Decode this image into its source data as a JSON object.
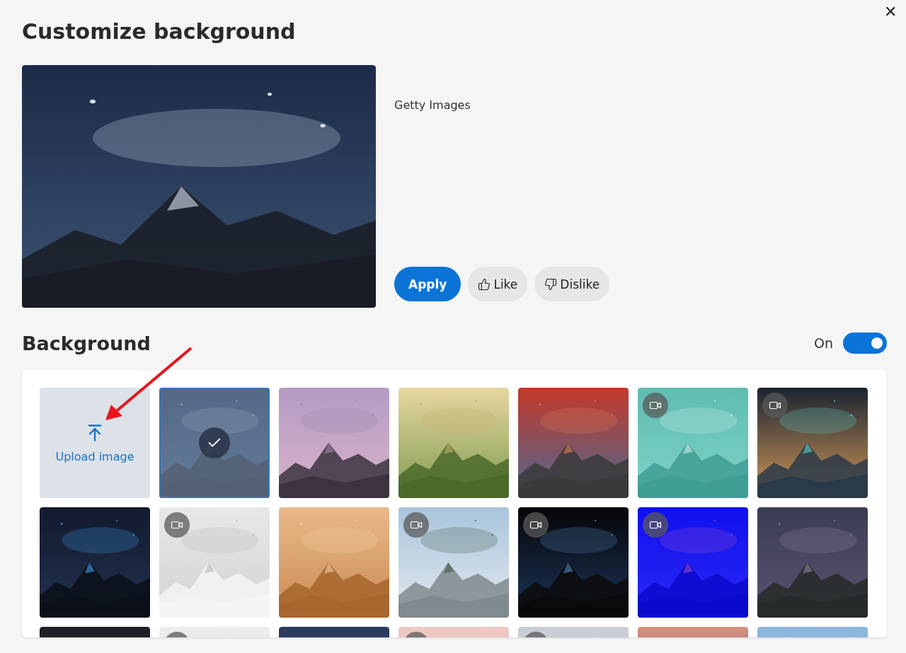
{
  "dialog": {
    "title": "Customize background",
    "close_label": "✕"
  },
  "preview": {
    "kind": "picture",
    "credit": "Getty Images"
  },
  "actions": [
    {
      "kind": "primary",
      "label": "Apply"
    },
    {
      "kind": "like",
      "label": "Like"
    },
    {
      "kind": "dislike",
      "label": "Dislike"
    }
  ],
  "background": {
    "heading": "Background",
    "toggle": {
      "label": "On",
      "on": true
    }
  },
  "tiles": [
    {
      "kind": "upload",
      "label": "Upload image"
    },
    {
      "kind": "picture",
      "selected": true,
      "video": false
    },
    {
      "kind": "picture",
      "selected": false,
      "video": false
    },
    {
      "kind": "picture",
      "selected": false,
      "video": false
    },
    {
      "kind": "picture",
      "selected": false,
      "video": false
    },
    {
      "kind": "picture",
      "selected": false,
      "video": true
    },
    {
      "kind": "picture",
      "selected": false,
      "video": true
    },
    {
      "kind": "picture",
      "selected": false,
      "video": false
    },
    {
      "kind": "picture",
      "selected": false,
      "video": true
    },
    {
      "kind": "picture",
      "selected": false,
      "video": false
    },
    {
      "kind": "picture",
      "selected": false,
      "video": true
    },
    {
      "kind": "picture",
      "selected": false,
      "video": true
    },
    {
      "kind": "picture",
      "selected": false,
      "video": true
    },
    {
      "kind": "picture",
      "selected": false,
      "video": false
    },
    {
      "kind": "picture",
      "selected": false,
      "video": false
    },
    {
      "kind": "picture",
      "selected": false,
      "video": true
    },
    {
      "kind": "picture",
      "selected": false,
      "video": false
    },
    {
      "kind": "picture",
      "selected": false,
      "video": true
    },
    {
      "kind": "picture",
      "selected": false,
      "video": true
    },
    {
      "kind": "picture",
      "selected": false,
      "video": false
    },
    {
      "kind": "picture",
      "selected": false,
      "video": false
    }
  ],
  "annotation": {
    "kind": "arrow"
  }
}
